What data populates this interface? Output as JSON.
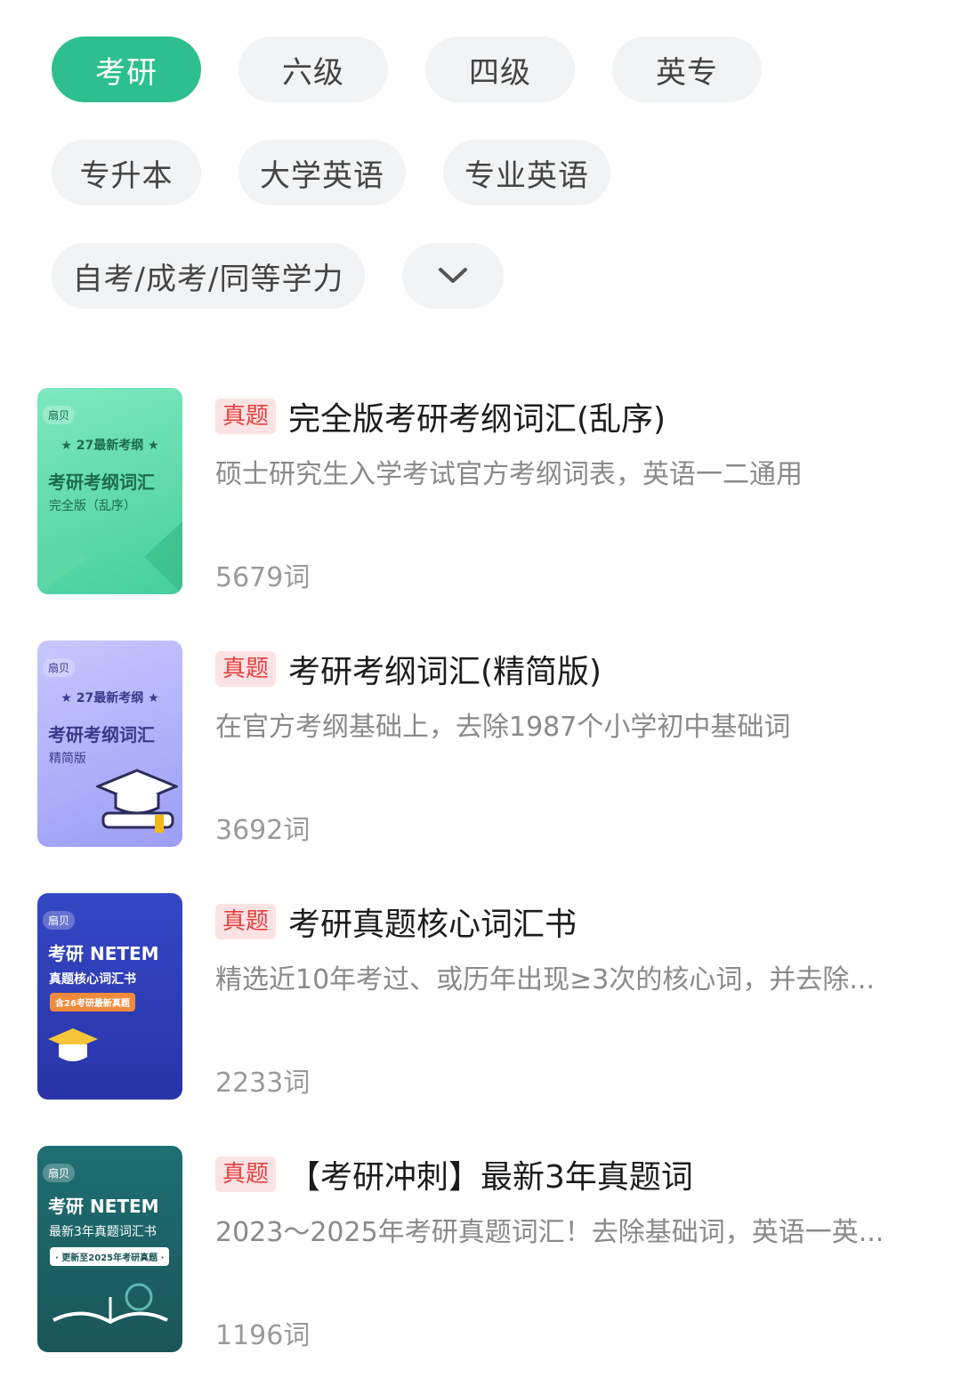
{
  "filters": {
    "chips": [
      {
        "label": "考研",
        "active": true
      },
      {
        "label": "六级",
        "active": false
      },
      {
        "label": "四级",
        "active": false
      },
      {
        "label": "英专",
        "active": false
      },
      {
        "label": "专升本",
        "active": false
      },
      {
        "label": "大学英语",
        "active": false
      },
      {
        "label": "专业英语",
        "active": false
      },
      {
        "label": "自考/成考/同等学力",
        "active": false
      }
    ],
    "expand_icon": "chevron-down-icon",
    "active_color": "#2dbf8f"
  },
  "books": [
    {
      "badge": "真题",
      "title": "完全版考研考纲词汇(乱序)",
      "desc": "硕士研究生入学考试官方考纲词表，英语一二通用",
      "count": "5679词",
      "cover": {
        "brand": "扇贝",
        "line1": "★ 27最新考纲 ★",
        "title": "考研考纲词汇",
        "sub": "完全版（乱序）"
      }
    },
    {
      "badge": "真题",
      "title": "考研考纲词汇(精简版)",
      "desc": "在官方考纲基础上，去除1987个小学初中基础词",
      "count": "3692词",
      "cover": {
        "brand": "扇贝",
        "line1": "★ 27最新考纲 ★",
        "title": "考研考纲词汇",
        "sub": "精简版"
      }
    },
    {
      "badge": "真题",
      "title": "考研真题核心词汇书",
      "desc": "精选近10年考过、或历年出现≥3次的核心词，并去除...",
      "count": "2233词",
      "cover": {
        "brand": "扇贝",
        "line1": "考研 NETEM",
        "title": "真题核心词汇书",
        "sub": "含26考研最新真题"
      }
    },
    {
      "badge": "真题",
      "title": "【考研冲刺】最新3年真题词",
      "desc": "2023～2025年考研真题词汇！去除基础词，英语一英...",
      "count": "1196词",
      "cover": {
        "brand": "扇贝",
        "line1": "考研 NETEM",
        "title": "最新3年真题词汇书",
        "sub": "· 更新至2025年考研真题 ·"
      }
    }
  ]
}
